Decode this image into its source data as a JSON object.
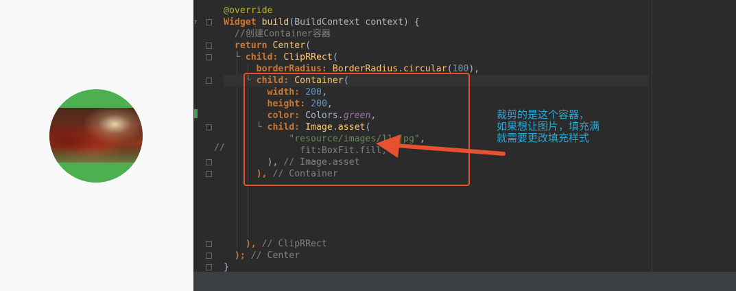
{
  "editor": {
    "gutter_comment": "//",
    "lines": {
      "l1": [
        "@override"
      ],
      "l2": [
        "Widget ",
        "build",
        "(BuildContext context) {"
      ],
      "l3": [
        "  //创建Container容器"
      ],
      "l4": [
        "  ",
        "return ",
        "Center",
        "("
      ],
      "l5": [
        "  └ ",
        "child: ",
        "ClipRRect",
        "("
      ],
      "l6": [
        "      ",
        "borderRadius: ",
        "BorderRadius",
        ".",
        "circular",
        "(",
        "100",
        "),"
      ],
      "l7": [
        "    └ ",
        "child: ",
        "Container",
        "("
      ],
      "l8": [
        "        ",
        "width: ",
        "200",
        ","
      ],
      "l9": [
        "        ",
        "height: ",
        "200",
        ","
      ],
      "l10": [
        "        ",
        "color: ",
        "Colors.",
        "green",
        ","
      ],
      "l11": [
        "      └ ",
        "child: ",
        "Image",
        ".",
        "asset",
        "("
      ],
      "l12": [
        "            ",
        "\"resource/images/11.jpg\"",
        ","
      ],
      "l13": [
        "              ",
        "fit:BoxFit.fill,"
      ],
      "l14": [
        "        ",
        "), ",
        "// Image.asset"
      ],
      "l15": [
        "      ",
        "), ",
        "// Container"
      ],
      "l16": [
        "    ",
        "), ",
        "// ClipRRect"
      ],
      "l17": [
        "  ",
        "); ",
        "// Center"
      ],
      "l18": [
        "}"
      ]
    }
  },
  "annotation": {
    "line1": "裁剪的是这个容器，",
    "line2": "如果想让图片，填充满",
    "line3": "就需要更改填充样式"
  },
  "colors": {
    "annotation_text": "#29a8d6",
    "highlight_box": "#e8512f",
    "preview_container": "#4caf50",
    "editor_bg": "#2b2b2b"
  }
}
